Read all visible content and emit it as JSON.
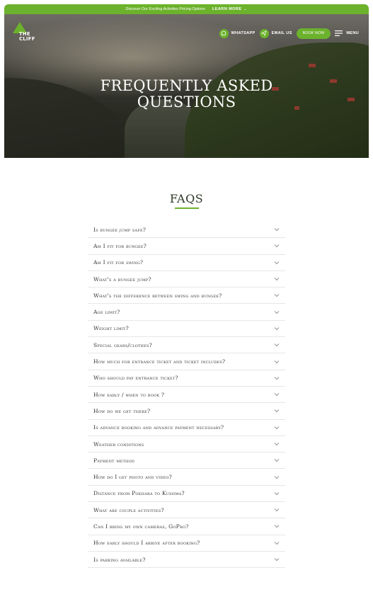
{
  "announcement": {
    "text": "Discover Our Exciting Activities Pricing Options",
    "link": "LEARN MORE →"
  },
  "logo": {
    "line1": "THE",
    "line2": "CLIFF"
  },
  "nav": {
    "whatsapp": "WHATSAPP",
    "email": "EMAIL US",
    "book": "BOOK NOW",
    "menu": "MENU"
  },
  "hero": {
    "line1": "FREQUENTLY ASKED",
    "line2": "QUESTIONS"
  },
  "faq_heading": "FAQS",
  "faqs": [
    "Is bungee jump safe?",
    "Am I fit for bungee?",
    "Am I fit for swing?",
    "What's a bungee jump?",
    "What's the difference between swing and bungee?",
    "Age limit?",
    "Weight limit?",
    "Special gears/clothes?",
    "How much for entrance ticket and ticket includes?",
    "Who should pay entrance ticket?",
    "How early / when to book ?",
    "How do we get there?",
    "Is advance booking and advance payment necessary?",
    "Weather conditions",
    "Payment method",
    "How do I get photo and video?",
    "Distance from Pokhara to Kushma?",
    "What are couple activities?",
    "Can I bring my own cameras, GoPro?",
    "How early should I arrive after booking?",
    "Is parking available?"
  ],
  "colors": {
    "brand_green": "#6cb22c",
    "heading": "#2f3b2a"
  },
  "icons": [
    "whatsapp-icon",
    "send-icon",
    "hamburger-icon",
    "chevron-down-icon"
  ]
}
